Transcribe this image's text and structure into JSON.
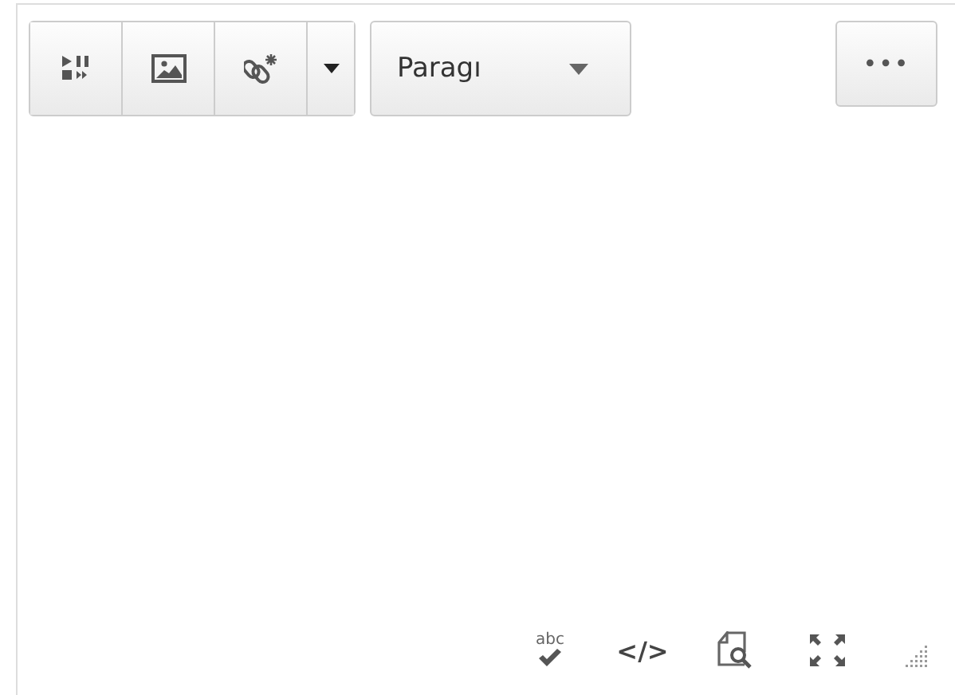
{
  "toolbar": {
    "buttons": [
      {
        "kind": "media"
      },
      {
        "kind": "image"
      },
      {
        "kind": "link"
      },
      {
        "kind": "caret"
      }
    ],
    "format_select": {
      "value": "Paragı"
    },
    "more_button": {
      "label": "•••"
    }
  },
  "status_bar": {
    "tools": [
      {
        "kind": "spellcheck",
        "label": "abc"
      },
      {
        "kind": "code",
        "label": "</>"
      },
      {
        "kind": "preview"
      },
      {
        "kind": "fullscreen"
      }
    ]
  }
}
